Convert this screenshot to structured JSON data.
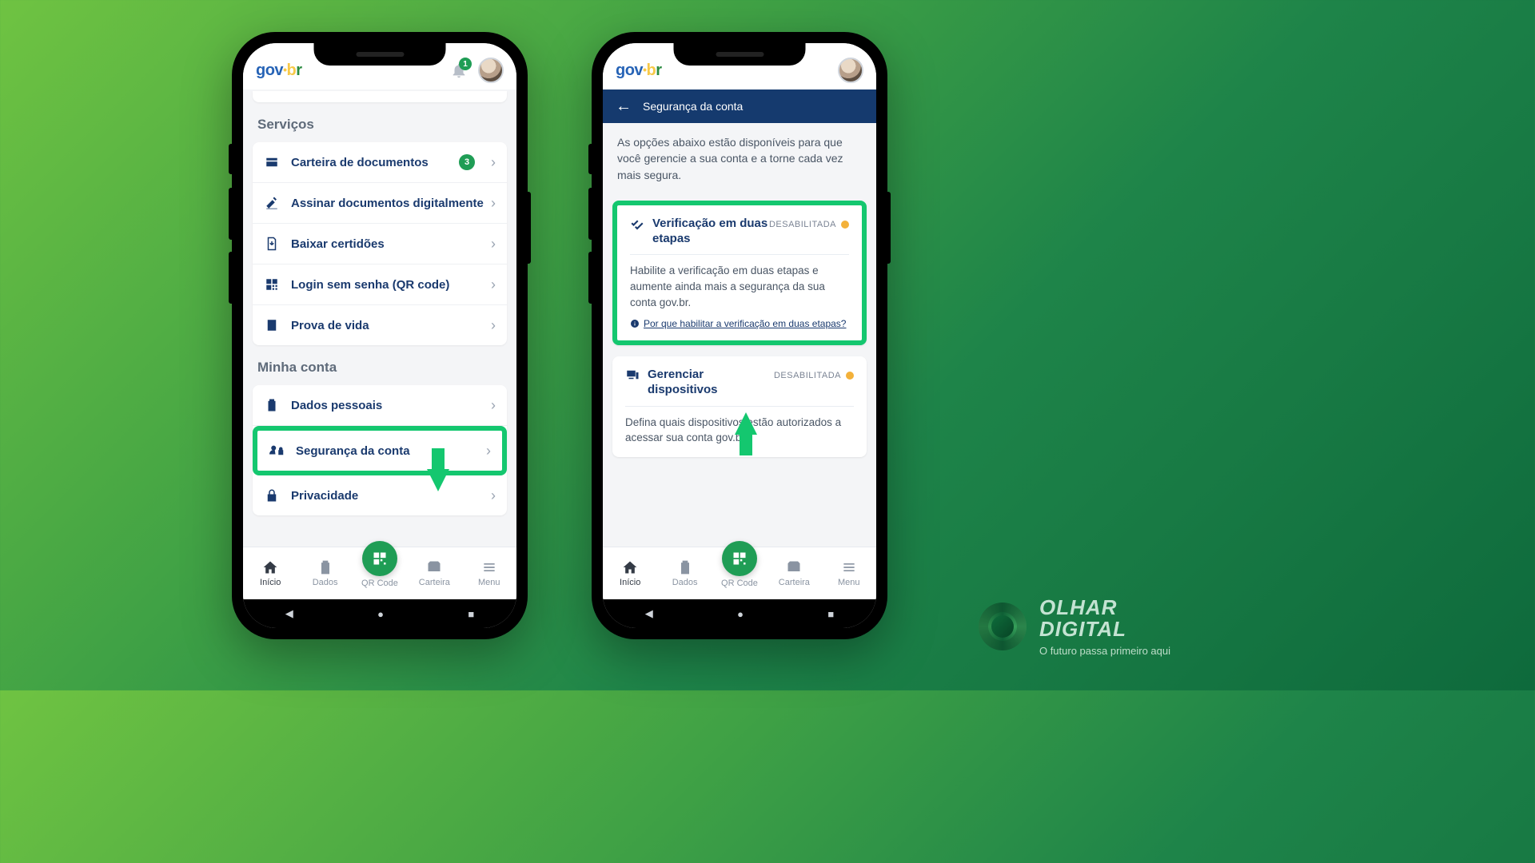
{
  "brand": {
    "name": "OLHAR",
    "name2": "DIGITAL",
    "tagline": "O futuro passa primeiro aqui"
  },
  "logo": {
    "prefix": "gov",
    "dot": "•",
    "suffix": "br"
  },
  "notifications_count": "1",
  "phone1": {
    "sections": {
      "servicos_title": "Serviços",
      "minha_conta_title": "Minha conta"
    },
    "servicos": [
      {
        "label": "Carteira de documentos",
        "icon": "wallet-card",
        "badge": "3"
      },
      {
        "label": "Assinar documentos digitalmente",
        "icon": "signature"
      },
      {
        "label": "Baixar certidões",
        "icon": "download-doc"
      },
      {
        "label": "Login sem senha (QR code)",
        "icon": "qr"
      },
      {
        "label": "Prova de vida",
        "icon": "id"
      }
    ],
    "minha_conta": [
      {
        "label": "Dados pessoais",
        "icon": "clipboard"
      },
      {
        "label": "Segurança da conta",
        "icon": "user-lock",
        "highlight": true
      },
      {
        "label": "Privacidade",
        "icon": "lock"
      }
    ],
    "nav": {
      "inicio": "Início",
      "dados": "Dados",
      "qr": "QR Code",
      "carteira": "Carteira",
      "menu": "Menu"
    }
  },
  "phone2": {
    "subheader": "Segurança da conta",
    "intro": "As opções abaixo estão disponíveis para que você gerencie a sua conta e a torne cada vez mais segura.",
    "card1": {
      "title": "Verificação em duas etapas",
      "status": "DESABILITADA",
      "body": "Habilite a verificação em duas etapas e aumente ainda mais a segurança da sua conta gov.br.",
      "link": "Por que habilitar a verificação em duas etapas?"
    },
    "card2": {
      "title": "Gerenciar dispositivos",
      "status": "DESABILITADA",
      "body": "Defina quais dispositivos estão autorizados a acessar sua conta gov.br"
    },
    "nav": {
      "inicio": "Início",
      "dados": "Dados",
      "qr": "QR Code",
      "carteira": "Carteira",
      "menu": "Menu"
    }
  }
}
